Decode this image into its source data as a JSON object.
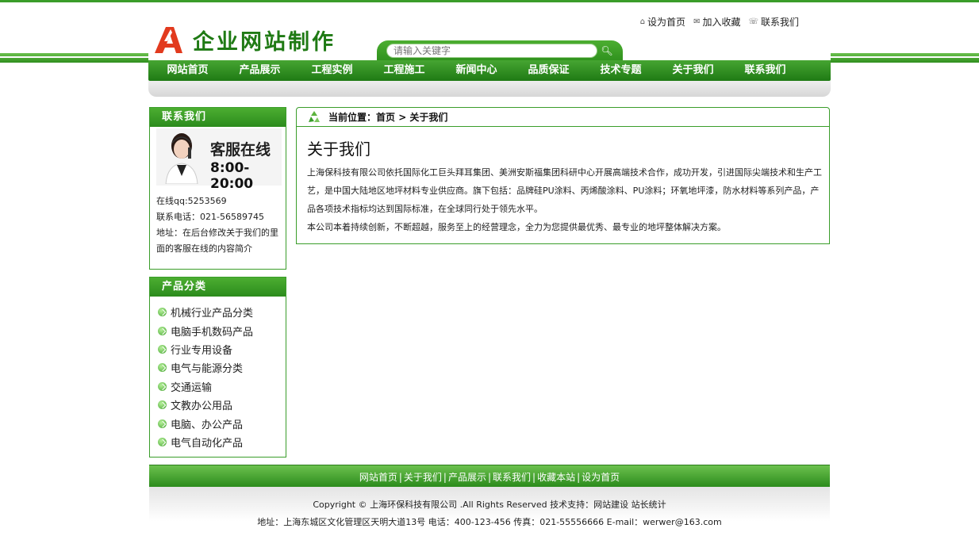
{
  "header": {
    "logo_text": "企业网站制作",
    "top_links": [
      {
        "label": "设为首页",
        "icon": "home-icon"
      },
      {
        "label": "加入收藏",
        "icon": "bookmark-icon"
      },
      {
        "label": "联系我们",
        "icon": "contact-icon"
      }
    ],
    "search": {
      "placeholder": "请输入关键字",
      "value": ""
    }
  },
  "nav": {
    "items": [
      "网站首页",
      "产品展示",
      "工程实例",
      "工程施工",
      "新闻中心",
      "品质保证",
      "技术专题",
      "关于我们",
      "联系我们"
    ]
  },
  "sidebar": {
    "contact": {
      "title": "联系我们",
      "service_title": "客服在线",
      "service_hours": "8:00-20:00",
      "qq": "在线qq:5253569",
      "phone": "联系电话：021-56589745",
      "address": "地址：在后台修改关于我们的里面的客服在线的内容简介"
    },
    "categories": {
      "title": "产品分类",
      "items": [
        "机械行业产品分类",
        "电脑手机数码产品",
        "行业专用设备",
        "电气与能源分类",
        "交通运输",
        "文教办公用品",
        "电脑、办公产品",
        "电气自动化产品"
      ]
    }
  },
  "main": {
    "breadcrumb_label": "当前位置：",
    "breadcrumb_path": "首页 > 关于我们",
    "title": "关于我们",
    "paragraphs": [
      "上海保科技有限公司依托国际化工巨头拜耳集团、美洲安斯福集团科研中心开展高端技术合作，成功开发，引进国际尖端技术和生产工艺，是中国大陆地区地坪材料专业供应商。旗下包括：品牌硅PU涂料、丙烯酸涂料、PU涂料；环氧地坪漆，防水材料等系列产品，产品各项技术指标均达到国际标准，在全球同行处于领先水平。",
      "本公司本着持续创新，不断超越，服务至上的经营理念，全力为您提供最优秀、最专业的地坪整体解决方案。"
    ]
  },
  "footer": {
    "links": [
      "网站首页",
      "关于我们",
      "产品展示",
      "联系我们",
      "收藏本站",
      "设为首页"
    ],
    "copyright": "Copyright © 上海环保科技有限公司 .All Rights Reserved 技术支持：网站建设 站长统计",
    "address": "地址：上海东城区文化管理区天明大道13号 电话：400-123-456 传真：021-55556666 E-mail：werwer@163.com"
  },
  "colors": {
    "brand_green": "#2b8b1c",
    "logo_red": "#e23a1e"
  }
}
